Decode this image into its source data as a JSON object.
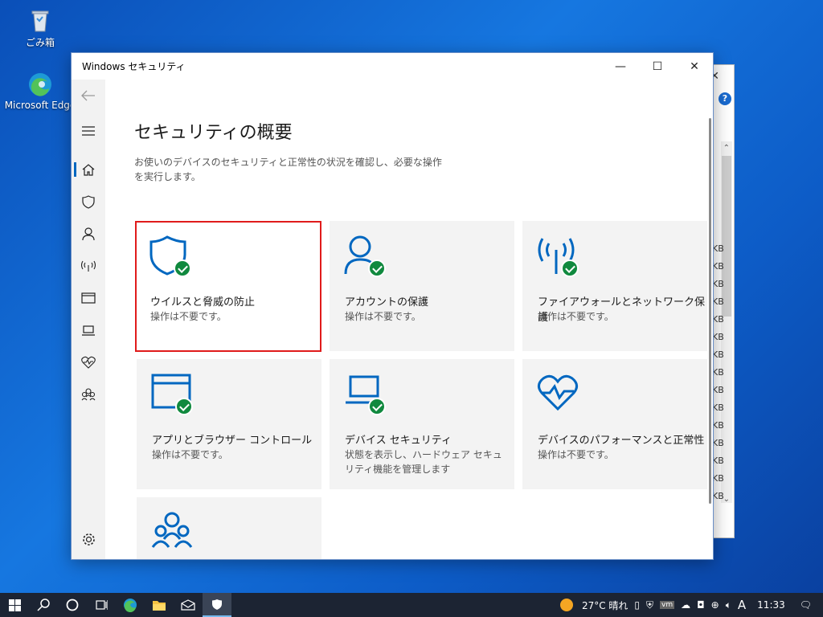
{
  "desktop": {
    "icons": [
      {
        "label": "ごみ箱",
        "icon": "recycle-bin-icon"
      },
      {
        "label": "Microsoft Edge",
        "icon": "edge-icon"
      }
    ]
  },
  "background_window": {
    "kb_label": "KB"
  },
  "window": {
    "title": "Windows セキュリティ",
    "controls": {
      "minimize": "—",
      "maximize": "☐",
      "close": "✕"
    }
  },
  "sidebar": {
    "items": [
      {
        "name": "back",
        "icon": "back-arrow-icon"
      },
      {
        "name": "menu",
        "icon": "hamburger-menu-icon"
      },
      {
        "name": "home",
        "icon": "home-icon",
        "active": true
      },
      {
        "name": "virus",
        "icon": "shield-icon"
      },
      {
        "name": "account",
        "icon": "person-icon"
      },
      {
        "name": "firewall",
        "icon": "wifi-antenna-icon"
      },
      {
        "name": "app-browser",
        "icon": "app-window-icon"
      },
      {
        "name": "device-security",
        "icon": "laptop-icon"
      },
      {
        "name": "device-performance",
        "icon": "heart-pulse-icon"
      },
      {
        "name": "family",
        "icon": "family-icon"
      },
      {
        "name": "settings",
        "icon": "gear-icon"
      }
    ]
  },
  "main": {
    "title": "セキュリティの概要",
    "description": "お使いのデバイスのセキュリティと正常性の状況を確認し、必要な操作を実行します。",
    "tiles": [
      {
        "name": "ウイルスと脅威の防止",
        "status": "操作は不要です。",
        "icon": "shield-icon",
        "selected": true
      },
      {
        "name": "アカウントの保護",
        "status": "操作は不要です。",
        "icon": "person-icon"
      },
      {
        "name": "ファイアウォールとネットワーク保護",
        "status": "操作は不要です。",
        "icon": "wifi-antenna-icon"
      },
      {
        "name": "アプリとブラウザー コントロール",
        "status": "操作は不要です。",
        "icon": "app-window-icon"
      },
      {
        "name": "デバイス セキュリティ",
        "status": "状態を表示し、ハードウェア セキュリティ機能を管理します",
        "icon": "laptop-icon"
      },
      {
        "name": "デバイスのパフォーマンスと正常性",
        "status": "操作は不要です。",
        "icon": "heart-pulse-icon"
      },
      {
        "name": "",
        "status": "",
        "icon": "family-icon"
      }
    ]
  },
  "taskbar": {
    "weather": "27°C 晴れ",
    "ime": "A",
    "time": "11:33",
    "colors": {
      "accent": "#0067c0",
      "check": "#10893e",
      "highlight": "#e01b1b"
    }
  }
}
